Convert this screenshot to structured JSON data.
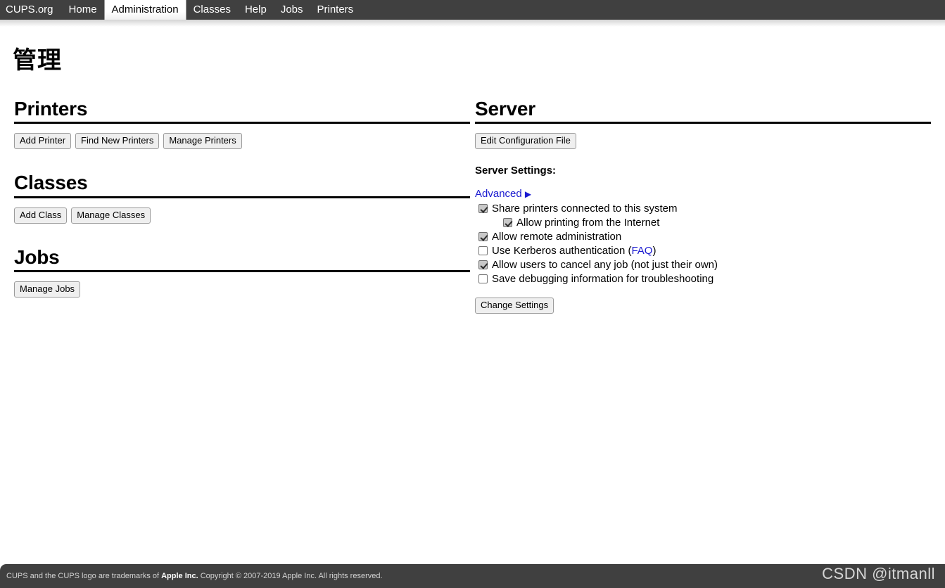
{
  "nav": {
    "items": [
      {
        "label": "CUPS.org",
        "active": false,
        "brand": true
      },
      {
        "label": "Home",
        "active": false,
        "brand": false
      },
      {
        "label": "Administration",
        "active": true,
        "brand": false
      },
      {
        "label": "Classes",
        "active": false,
        "brand": false
      },
      {
        "label": "Help",
        "active": false,
        "brand": false
      },
      {
        "label": "Jobs",
        "active": false,
        "brand": false
      },
      {
        "label": "Printers",
        "active": false,
        "brand": false
      }
    ]
  },
  "page": {
    "title": "管理"
  },
  "left_column": {
    "printers": {
      "heading": "Printers",
      "buttons": [
        "Add Printer",
        "Find New Printers",
        "Manage Printers"
      ]
    },
    "classes": {
      "heading": "Classes",
      "buttons": [
        "Add Class",
        "Manage Classes"
      ]
    },
    "jobs": {
      "heading": "Jobs",
      "buttons": [
        "Manage Jobs"
      ]
    }
  },
  "right_column": {
    "server": {
      "heading": "Server",
      "edit_config_button": "Edit Configuration File",
      "settings_label": "Server Settings:",
      "advanced_link": "Advanced",
      "advanced_arrow": "▶",
      "settings": [
        {
          "label": "Share printers connected to this system",
          "checked": true,
          "indented": false,
          "link": null
        },
        {
          "label": "Allow printing from the Internet",
          "checked": true,
          "indented": true,
          "link": null
        },
        {
          "label": "Allow remote administration",
          "checked": true,
          "indented": false,
          "link": null
        },
        {
          "label": "Use Kerberos authentication (",
          "checked": false,
          "indented": false,
          "link": "FAQ",
          "label_after": ")"
        },
        {
          "label": "Allow users to cancel any job (not just their own)",
          "checked": true,
          "indented": false,
          "link": null
        },
        {
          "label": "Save debugging information for troubleshooting",
          "checked": false,
          "indented": false,
          "link": null
        }
      ],
      "change_settings_button": "Change Settings"
    }
  },
  "footer": {
    "text_before": "CUPS and the CUPS logo are trademarks of ",
    "trademark": "Apple Inc.",
    "text_after": " Copyright © 2007-2019 Apple Inc. All rights reserved.",
    "watermark": "CSDN @itmanll"
  },
  "colors": {
    "navbar_bg": "#404040",
    "link": "#1a1ad0",
    "button_bg": "#efefef",
    "footer_bg": "#404040"
  }
}
